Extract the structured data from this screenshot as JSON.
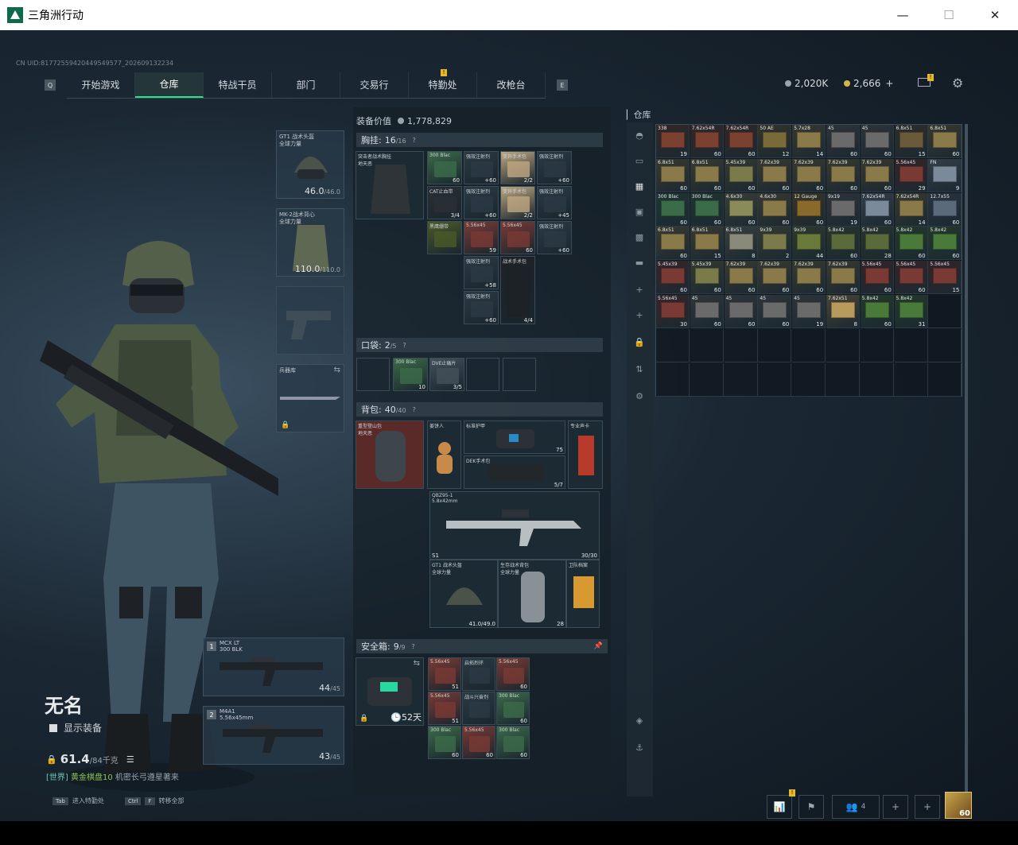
{
  "window": {
    "title": "三角洲行动"
  },
  "uid": "CN UID:817725594204495495​77_202609132234",
  "nav": {
    "left_key": "Q",
    "right_key": "E",
    "tabs": [
      {
        "label": "开始游戏"
      },
      {
        "label": "仓库",
        "active": true
      },
      {
        "label": "特战干员"
      },
      {
        "label": "部门"
      },
      {
        "label": "交易行"
      },
      {
        "label": "特勤处",
        "badge": "!"
      },
      {
        "label": "改枪台"
      }
    ]
  },
  "currency": {
    "silver": "2,020K",
    "gold": "2,666",
    "gold_add": "+"
  },
  "mail_badge": "!",
  "player": {
    "name": "无名",
    "show_equipment": "显示装备",
    "weight": "61.4",
    "weight_max": "/84千克",
    "season_prefix": "[世界]",
    "season_rank": "黄金棋盘10",
    "season_note": "机密长弓遵星著来"
  },
  "equip": {
    "helmet": {
      "label": "GT1 战术头盔\n全球力量",
      "dur": "46.0",
      "dur_max": "/46.0"
    },
    "armor": {
      "label": "MK-2战术背心\n全球力量",
      "dur": "110.0",
      "dur_max": "/110.0"
    },
    "melee": {
      "label": "兵器库"
    }
  },
  "weapons": [
    {
      "num": "1",
      "name": "MCX LT",
      "ammo_type": "300 BLK",
      "ammo": "44",
      "ammo_max": "/45"
    },
    {
      "num": "2",
      "name": "M4A1",
      "ammo_type": "5.56x45mm",
      "ammo": "43",
      "ammo_max": "/45"
    }
  ],
  "loadout": {
    "equip_value_label": "装备价值",
    "equip_value": "1,778,829",
    "chest": {
      "label": "胸挂:",
      "count": "16",
      "max": "/16",
      "rig_name": "突击者战术胸挂\n地天恶"
    },
    "pocket": {
      "label": "口袋:",
      "count": "2",
      "max": "/5"
    },
    "backpack": {
      "label": "背包:",
      "count": "40",
      "max": "/40",
      "pack_name": "重型登山包\n地天恶"
    },
    "safebox": {
      "label": "安全箱:",
      "count": "9",
      "max": "/9",
      "days": "52天"
    }
  },
  "chest_items": [
    {
      "l": "300 Blac",
      "c": "60",
      "col": "#3c6b4a"
    },
    {
      "l": "强效注射剂",
      "c": "+60",
      "col": "#2a3a44"
    },
    {
      "l": "变异手术包",
      "c": "2/2",
      "col": "#bfa882"
    },
    {
      "l": "强效注射剂",
      "c": "+60",
      "col": "#2a3a44"
    },
    {
      "l": "CAT止血带",
      "c": "3/4",
      "col": "#2a3034"
    },
    {
      "l": "强效注射剂",
      "c": "+60",
      "col": "#2a3a44"
    },
    {
      "l": "变异手术包",
      "c": "2/2",
      "col": "#bfa882"
    },
    {
      "l": "强效注射剂",
      "c": "+45",
      "col": "#2a3a44"
    },
    {
      "l": "黑鹰绷带",
      "c": "",
      "col": "#4a5a28"
    },
    {
      "l": "5.56x45",
      "c": "59",
      "col": "#7a3a34"
    },
    {
      "l": "5.56x45",
      "c": "60",
      "col": "#7a3a34"
    },
    {
      "l": "强效注射剂",
      "c": "+60",
      "col": "#2a3a44"
    },
    {
      "l": "强效注射剂",
      "c": "+58",
      "col": "#2a3a44"
    },
    {
      "l": "战术手术包",
      "c": "4/4",
      "col": "#1e2226"
    },
    {
      "l": "强效注射剂",
      "c": "+60",
      "col": "#2a3a44"
    }
  ],
  "pocket_items": [
    {
      "l": "300 Blac",
      "c": "10",
      "col": "#3c6b4a"
    },
    {
      "l": "DVE止痛片",
      "c": "3/5",
      "col": "#44505a"
    }
  ],
  "backpack_items": {
    "gingerbread": {
      "l": "姜饼人",
      "c": ""
    },
    "armor_box": {
      "l": "标准护甲",
      "c": "75"
    },
    "card": {
      "l": "专业声卡",
      "c": ""
    },
    "surgery": {
      "l": "DEK手术包",
      "c": "5/7"
    },
    "rifle": {
      "l": "QBZ95-1\n5.8x42mm",
      "c": "30/30",
      "tag": "S1"
    },
    "helmet2": {
      "l": "GT1 战术头盔\n全球力量",
      "c": "41.0/49.0"
    },
    "suit": {
      "l": "生存战术背包\n全球力量",
      "c": "28"
    },
    "dog_tag": {
      "l": "卫队档案",
      "c": ""
    }
  },
  "safe_items": [
    {
      "l": "5.56x45",
      "c": "51",
      "col": "#7a3a34"
    },
    {
      "l": "启拓烈环",
      "c": "",
      "col": "#2a3a44"
    },
    {
      "l": "5.56x45",
      "c": "60",
      "col": "#7a3a34"
    },
    {
      "l": "5.56x45",
      "c": "51",
      "col": "#7a3a34"
    },
    {
      "l": "战斗兴奋剂",
      "c": "",
      "col": "#2a3a44"
    },
    {
      "l": "300 Blac",
      "c": "60",
      "col": "#3c6b4a"
    },
    {
      "l": "300 Blac",
      "c": "60",
      "col": "#3c6b4a"
    },
    {
      "l": "5.56x45",
      "c": "60",
      "col": "#7a3a34"
    },
    {
      "l": "300 Blac",
      "c": "60",
      "col": "#3c6b4a"
    }
  ],
  "stash": {
    "title": "仓库",
    "items": [
      {
        "l": "338",
        "c": "19",
        "col": "#7a4030"
      },
      {
        "l": "7.62x54R",
        "c": "60",
        "col": "#7a4030"
      },
      {
        "l": "7.62x54R",
        "c": "60",
        "col": "#7a4030"
      },
      {
        "l": "50 AE",
        "c": "12",
        "col": "#7a6a3a"
      },
      {
        "l": "5.7x28",
        "c": "14",
        "col": "#8a7a4a"
      },
      {
        "l": "45",
        "c": "60",
        "col": "#6a6a6a"
      },
      {
        "l": "45",
        "c": "60",
        "col": "#6a6a6a"
      },
      {
        "l": "6.8x51",
        "c": "15",
        "col": "#6a5a3a"
      },
      {
        "l": "6.8x51",
        "c": "60",
        "col": "#8a7a4a"
      },
      {
        "l": "6.8x51",
        "c": "60",
        "col": "#8a7a4a"
      },
      {
        "l": "6.8x51",
        "c": "60",
        "col": "#8a7a4a"
      },
      {
        "l": "5.45x39",
        "c": "60",
        "col": "#7a7a4a"
      },
      {
        "l": "7.62x39",
        "c": "60",
        "col": "#8a7a4a"
      },
      {
        "l": "7.62x39",
        "c": "60",
        "col": "#8a7a4a"
      },
      {
        "l": "7.62x39",
        "c": "60",
        "col": "#8a7a4a"
      },
      {
        "l": "7.62x39",
        "c": "60",
        "col": "#8a7a4a"
      },
      {
        "l": "5.56x45",
        "c": "29",
        "col": "#7a3a34"
      },
      {
        "l": "FN",
        "c": "9",
        "col": "#7a8a9a"
      },
      {
        "l": "300 Blac",
        "c": "60",
        "col": "#3c6b4a"
      },
      {
        "l": "300 Blac",
        "c": "60",
        "col": "#3c6b4a"
      },
      {
        "l": "4.6x30",
        "c": "60",
        "col": "#8a8a5a"
      },
      {
        "l": "4.6x30",
        "c": "60",
        "col": "#8a7a4a"
      },
      {
        "l": "12 Gauge",
        "c": "60",
        "col": "#8a6a2a"
      },
      {
        "l": "9x19",
        "c": "19",
        "col": "#6a6a6a"
      },
      {
        "l": "7.62x54R",
        "c": "60",
        "col": "#7a8a9a"
      },
      {
        "l": "7.62x54R",
        "c": "14",
        "col": "#8a7a4a"
      },
      {
        "l": "12.7x55",
        "c": "60",
        "col": "#5a6a7a"
      },
      {
        "l": "6.8x51",
        "c": "60",
        "col": "#8a7a4a"
      },
      {
        "l": "6.8x51",
        "c": "15",
        "col": "#8a7a4a"
      },
      {
        "l": "6.8x51",
        "c": "8",
        "col": "#8a8a7a"
      },
      {
        "l": "9x39",
        "c": "2",
        "col": "#7a7a4a"
      },
      {
        "l": "9x39",
        "c": "44",
        "col": "#6a7a3a"
      },
      {
        "l": "5.8x42",
        "c": "60",
        "col": "#5a6a3a"
      },
      {
        "l": "5.8x42",
        "c": "28",
        "col": "#5a6a3a"
      },
      {
        "l": "5.8x42",
        "c": "60",
        "col": "#4a7a3a"
      },
      {
        "l": "5.8x42",
        "c": "60",
        "col": "#4a7a3a"
      },
      {
        "l": "5.45x39",
        "c": "60",
        "col": "#7a3a34"
      },
      {
        "l": "5.45x39",
        "c": "60",
        "col": "#7a7a4a"
      },
      {
        "l": "7.62x39",
        "c": "60",
        "col": "#8a7a4a"
      },
      {
        "l": "7.62x39",
        "c": "60",
        "col": "#8a7a4a"
      },
      {
        "l": "7.62x39",
        "c": "60",
        "col": "#8a7a4a"
      },
      {
        "l": "7.62x39",
        "c": "60",
        "col": "#8a7a4a"
      },
      {
        "l": "5.56x45",
        "c": "60",
        "col": "#7a3a34"
      },
      {
        "l": "5.56x45",
        "c": "60",
        "col": "#7a3a34"
      },
      {
        "l": "5.56x45",
        "c": "15",
        "col": "#7a3a34"
      },
      {
        "l": "5.56x45",
        "c": "30",
        "col": "#7a3a34"
      },
      {
        "l": "45",
        "c": "60",
        "col": "#6a6a6a"
      },
      {
        "l": "45",
        "c": "60",
        "col": "#6a6a6a"
      },
      {
        "l": "45",
        "c": "60",
        "col": "#6a6a6a"
      },
      {
        "l": "45",
        "c": "19",
        "col": "#6a6a6a"
      },
      {
        "l": "7.62x51",
        "c": "8",
        "col": "#b89a5a"
      },
      {
        "l": "5.8x42",
        "c": "60",
        "col": "#4a7a3a"
      },
      {
        "l": "5.8x42",
        "c": "31",
        "col": "#4a7a3a"
      }
    ]
  },
  "bottom": {
    "hint1_key": "Tab",
    "hint1": "进入特勤处",
    "hint2_key1": "Ctrl",
    "hint2_key2": "F",
    "hint2": "转移全部",
    "friends": "4",
    "level": "60",
    "stats_badge": "!"
  }
}
